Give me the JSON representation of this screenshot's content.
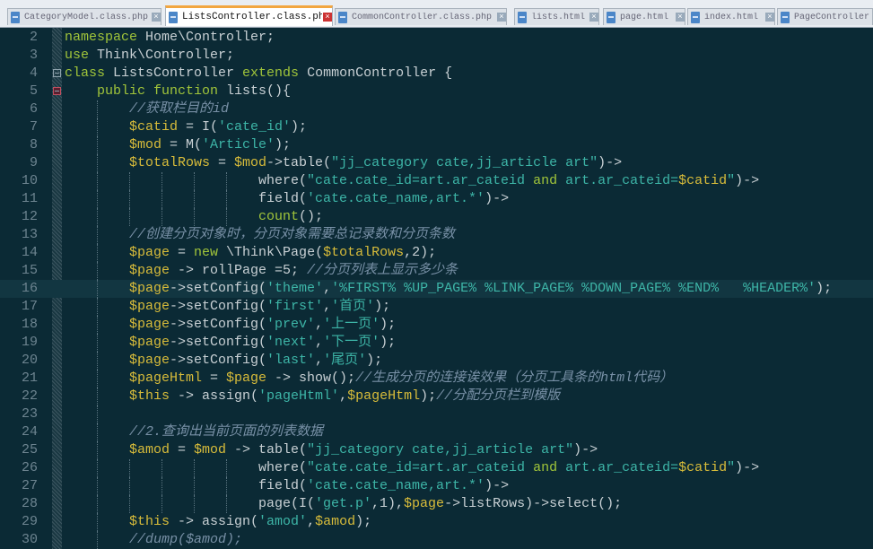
{
  "tabs": [
    {
      "label": "CategoryModel.class.php",
      "active": false
    },
    {
      "label": "ListsController.class.php",
      "active": true
    },
    {
      "label": "CommonController.class.php",
      "active": false
    },
    {
      "label": "lists.html",
      "active": false
    },
    {
      "label": "page.html",
      "active": false
    },
    {
      "label": "index.html",
      "active": false
    },
    {
      "label": "PageController",
      "active": false
    }
  ],
  "close_glyph": "×",
  "highlighted_line": 16,
  "lines": [
    {
      "n": 2,
      "t": [
        [
          "k",
          "namespace"
        ],
        [
          "p",
          " Home\\Controller;"
        ]
      ]
    },
    {
      "n": 3,
      "t": [
        [
          "k",
          "use"
        ],
        [
          "p",
          " Think\\Controller;"
        ]
      ]
    },
    {
      "n": 4,
      "fold": "open",
      "t": [
        [
          "k",
          "class"
        ],
        [
          "p",
          " ListsController "
        ],
        [
          "k",
          "extends"
        ],
        [
          "p",
          " CommonController {"
        ]
      ]
    },
    {
      "n": 5,
      "fold": "red",
      "t": [
        [
          "p",
          "    "
        ],
        [
          "k",
          "public"
        ],
        [
          "p",
          " "
        ],
        [
          "k",
          "function"
        ],
        [
          "p",
          " lists(){"
        ]
      ]
    },
    {
      "n": 6,
      "t": [
        [
          "p",
          "        "
        ],
        [
          "c",
          "//获取栏目的id"
        ]
      ]
    },
    {
      "n": 7,
      "t": [
        [
          "p",
          "        "
        ],
        [
          "v",
          "$catid"
        ],
        [
          "p",
          " = I("
        ],
        [
          "s",
          "'cate_id'"
        ],
        [
          "p",
          ");"
        ]
      ]
    },
    {
      "n": 8,
      "t": [
        [
          "p",
          "        "
        ],
        [
          "v",
          "$mod"
        ],
        [
          "p",
          " = M("
        ],
        [
          "s",
          "'Article'"
        ],
        [
          "p",
          ");"
        ]
      ]
    },
    {
      "n": 9,
      "t": [
        [
          "p",
          "        "
        ],
        [
          "v",
          "$totalRows"
        ],
        [
          "p",
          " = "
        ],
        [
          "v",
          "$mod"
        ],
        [
          "p",
          "->table("
        ],
        [
          "s",
          "\"jj_category cate,jj_article art\""
        ],
        [
          "p",
          ")->"
        ]
      ]
    },
    {
      "n": 10,
      "t": [
        [
          "p",
          "                        "
        ],
        [
          "p",
          "where("
        ],
        [
          "s",
          "\"cate.cate_id=art.ar_cateid "
        ],
        [
          "k",
          "and"
        ],
        [
          "s",
          " art.ar_cateid="
        ],
        [
          "v",
          "$catid"
        ],
        [
          "s",
          "\""
        ],
        [
          "p",
          ")->"
        ]
      ]
    },
    {
      "n": 11,
      "t": [
        [
          "p",
          "                        "
        ],
        [
          "p",
          "field("
        ],
        [
          "s",
          "'cate.cate_name,art.*'"
        ],
        [
          "p",
          ")->"
        ]
      ]
    },
    {
      "n": 12,
      "t": [
        [
          "p",
          "                        "
        ],
        [
          "k",
          "count"
        ],
        [
          "p",
          "();"
        ]
      ]
    },
    {
      "n": 13,
      "t": [
        [
          "p",
          "        "
        ],
        [
          "c",
          "//创建分页对象时，分页对象需要总记录数和分页条数"
        ]
      ]
    },
    {
      "n": 14,
      "t": [
        [
          "p",
          "        "
        ],
        [
          "v",
          "$page"
        ],
        [
          "p",
          " = "
        ],
        [
          "k",
          "new"
        ],
        [
          "p",
          " \\Think\\Page("
        ],
        [
          "v",
          "$totalRows"
        ],
        [
          "p",
          ",2);"
        ]
      ]
    },
    {
      "n": 15,
      "t": [
        [
          "p",
          "        "
        ],
        [
          "v",
          "$page"
        ],
        [
          "p",
          " -> rollPage =5; "
        ],
        [
          "c",
          "//分页列表上显示多少条"
        ]
      ]
    },
    {
      "n": 16,
      "t": [
        [
          "p",
          "        "
        ],
        [
          "v",
          "$page"
        ],
        [
          "p",
          "->setConfig("
        ],
        [
          "s",
          "'theme'"
        ],
        [
          "p",
          ","
        ],
        [
          "s",
          "'%FIRST% %UP_PAGE% %LINK_PAGE% %DOWN_PAGE% %END%   %HEADER%'"
        ],
        [
          "p",
          ");"
        ]
      ]
    },
    {
      "n": 17,
      "t": [
        [
          "p",
          "        "
        ],
        [
          "v",
          "$page"
        ],
        [
          "p",
          "->setConfig("
        ],
        [
          "s",
          "'first'"
        ],
        [
          "p",
          ","
        ],
        [
          "s",
          "'首页'"
        ],
        [
          "p",
          ");"
        ]
      ]
    },
    {
      "n": 18,
      "t": [
        [
          "p",
          "        "
        ],
        [
          "v",
          "$page"
        ],
        [
          "p",
          "->setConfig("
        ],
        [
          "s",
          "'prev'"
        ],
        [
          "p",
          ","
        ],
        [
          "s",
          "'上一页'"
        ],
        [
          "p",
          ");"
        ]
      ]
    },
    {
      "n": 19,
      "t": [
        [
          "p",
          "        "
        ],
        [
          "v",
          "$page"
        ],
        [
          "p",
          "->setConfig("
        ],
        [
          "s",
          "'next'"
        ],
        [
          "p",
          ","
        ],
        [
          "s",
          "'下一页'"
        ],
        [
          "p",
          ");"
        ]
      ]
    },
    {
      "n": 20,
      "t": [
        [
          "p",
          "        "
        ],
        [
          "v",
          "$page"
        ],
        [
          "p",
          "->setConfig("
        ],
        [
          "s",
          "'last'"
        ],
        [
          "p",
          ","
        ],
        [
          "s",
          "'尾页'"
        ],
        [
          "p",
          ");"
        ]
      ]
    },
    {
      "n": 21,
      "t": [
        [
          "p",
          "        "
        ],
        [
          "v",
          "$pageHtml"
        ],
        [
          "p",
          " = "
        ],
        [
          "v",
          "$page"
        ],
        [
          "p",
          " -> show();"
        ],
        [
          "c",
          "//生成分页的连接诶效果（分页工具条的html代码）"
        ]
      ]
    },
    {
      "n": 22,
      "t": [
        [
          "p",
          "        "
        ],
        [
          "v",
          "$this"
        ],
        [
          "p",
          " -> assign("
        ],
        [
          "s",
          "'pageHtml'"
        ],
        [
          "p",
          ","
        ],
        [
          "v",
          "$pageHtml"
        ],
        [
          "p",
          ");"
        ],
        [
          "c",
          "//分配分页栏到模版"
        ]
      ]
    },
    {
      "n": 23,
      "t": [
        [
          "p",
          "        "
        ]
      ]
    },
    {
      "n": 24,
      "t": [
        [
          "p",
          "        "
        ],
        [
          "c",
          "//2.查询出当前页面的列表数据"
        ]
      ]
    },
    {
      "n": 25,
      "t": [
        [
          "p",
          "        "
        ],
        [
          "v",
          "$amod"
        ],
        [
          "p",
          " = "
        ],
        [
          "v",
          "$mod"
        ],
        [
          "p",
          " -> table("
        ],
        [
          "s",
          "\"jj_category cate,jj_article art\""
        ],
        [
          "p",
          ")->"
        ]
      ]
    },
    {
      "n": 26,
      "t": [
        [
          "p",
          "                        "
        ],
        [
          "p",
          "where("
        ],
        [
          "s",
          "\"cate.cate_id=art.ar_cateid "
        ],
        [
          "k",
          "and"
        ],
        [
          "s",
          " art.ar_cateid="
        ],
        [
          "v",
          "$catid"
        ],
        [
          "s",
          "\""
        ],
        [
          "p",
          ")->"
        ]
      ]
    },
    {
      "n": 27,
      "t": [
        [
          "p",
          "                        "
        ],
        [
          "p",
          "field("
        ],
        [
          "s",
          "'cate.cate_name,art.*'"
        ],
        [
          "p",
          ")->"
        ]
      ]
    },
    {
      "n": 28,
      "t": [
        [
          "p",
          "                        "
        ],
        [
          "p",
          "page(I("
        ],
        [
          "s",
          "'get.p'"
        ],
        [
          "p",
          ",1),"
        ],
        [
          "v",
          "$page"
        ],
        [
          "p",
          "->listRows)->select();"
        ]
      ]
    },
    {
      "n": 29,
      "t": [
        [
          "p",
          "        "
        ],
        [
          "v",
          "$this"
        ],
        [
          "p",
          " -> assign("
        ],
        [
          "s",
          "'amod'"
        ],
        [
          "p",
          ","
        ],
        [
          "v",
          "$amod"
        ],
        [
          "p",
          ");"
        ]
      ]
    },
    {
      "n": 30,
      "t": [
        [
          "p",
          "        "
        ],
        [
          "c",
          "//dump($amod);"
        ]
      ]
    }
  ]
}
